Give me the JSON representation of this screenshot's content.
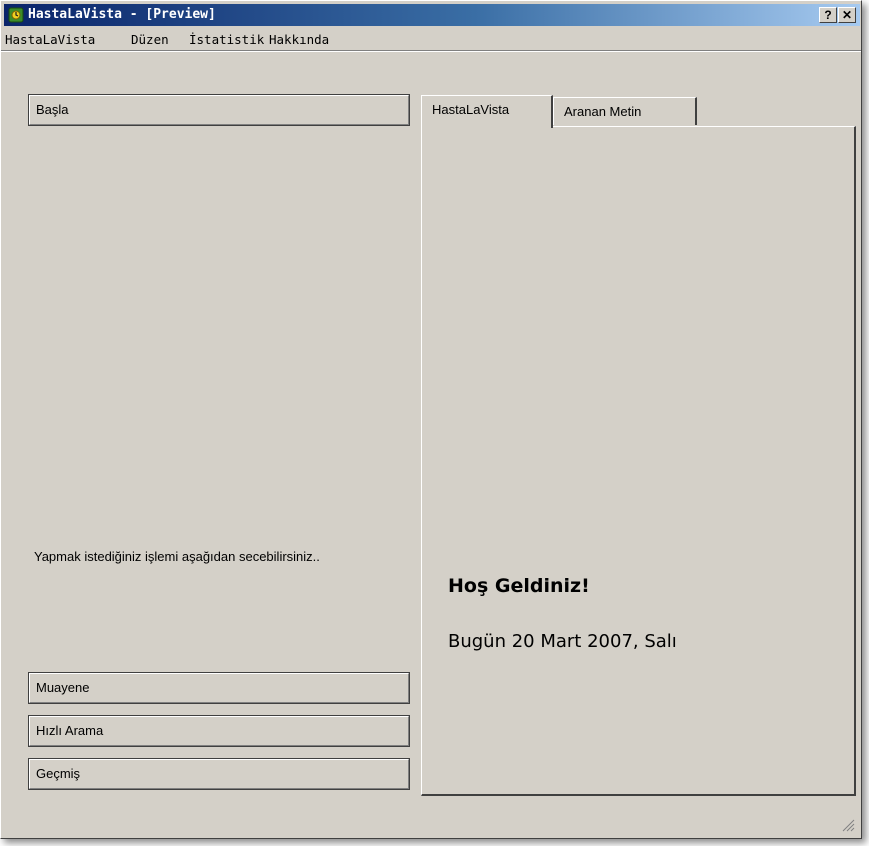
{
  "window": {
    "title": "HastaLaVista - [Preview]",
    "help_button": "?",
    "close_button": "✕"
  },
  "menu": {
    "items": [
      "HastaLaVista",
      "Düzen",
      "İstatistik",
      "Hakkında"
    ]
  },
  "left_panel": {
    "start_button": "Başla",
    "hint_text": "Yapmak istediğiniz işlemi aşağıdan secebilirsiniz..",
    "actions": [
      "Muayene",
      "Hızlı Arama",
      "Geçmiş"
    ]
  },
  "tabs": [
    {
      "label": "HastaLaVista",
      "active": true
    },
    {
      "label": "Aranan Metin",
      "active": false
    }
  ],
  "content": {
    "welcome": "Hoş Geldiniz!",
    "date_line": "Bugün 20 Mart 2007, Salı"
  },
  "colors": {
    "titlebar_start": "#0a246a",
    "titlebar_end": "#a6caf0",
    "face": "#d4d0c8"
  }
}
